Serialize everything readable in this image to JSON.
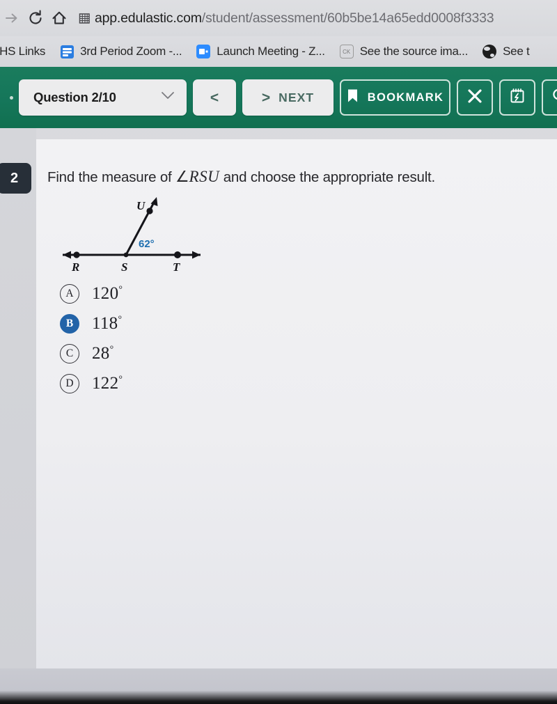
{
  "browser": {
    "nav": {
      "forward_icon": "arrow-right-icon",
      "reload_icon": "reload-icon",
      "home_icon": "home-icon"
    },
    "omnibox": {
      "site_icon": "building-grid-icon",
      "url_host": "app.edulastic.com",
      "url_path": "/student/assessment/60b5be14a65edd0008f3333"
    },
    "bookmarks": [
      {
        "label": "PHS Links",
        "icon": ""
      },
      {
        "label": "3rd Period Zoom -...",
        "icon": "zoom-doc-icon"
      },
      {
        "label": "Launch Meeting - Z...",
        "icon": "zoom-camera-icon"
      },
      {
        "label": "See the source ima...",
        "icon": "ck-hex-icon"
      },
      {
        "label": "See t",
        "icon": "globe-icon"
      }
    ]
  },
  "toolbar": {
    "background_color": "#15765a",
    "question_select": {
      "label": "Question 2/10",
      "chevron_icon": "chevron-down-icon"
    },
    "prev_label": "<",
    "next_label": "NEXT",
    "next_chevron": ">",
    "bookmark_label": "BOOKMARK",
    "bookmark_icon": "bookmark-icon",
    "close_icon": "close-x-icon",
    "notepad_icon": "notepad-icon",
    "search_icon": "magnifier-icon"
  },
  "question": {
    "number": "2",
    "badge_color": "#272f38",
    "prompt_before": "Find the measure of ",
    "prompt_angle_symbol": "∠",
    "prompt_angle_name": "RSU",
    "prompt_after": " and choose the appropriate result."
  },
  "diagram": {
    "type": "angle-on-line",
    "points": [
      "R",
      "S",
      "T",
      "U"
    ],
    "line_labels": {
      "left": "R",
      "vertex": "S",
      "right": "T",
      "ray": "U"
    },
    "angle_label": "62°",
    "angle_label_color": "#1f6fb0",
    "angle_between": [
      "SU",
      "ST"
    ],
    "line_color": "#15151a"
  },
  "options": [
    {
      "letter": "A",
      "value": "120",
      "degree": "°",
      "selected": false
    },
    {
      "letter": "B",
      "value": "118",
      "degree": "°",
      "selected": true
    },
    {
      "letter": "C",
      "value": "28",
      "degree": "°",
      "selected": false
    },
    {
      "letter": "D",
      "value": "122",
      "degree": "°",
      "selected": false
    }
  ],
  "colors": {
    "accent_teal": "#15765a",
    "selected_blue": "#2263a8",
    "badge_dark": "#272f38"
  }
}
